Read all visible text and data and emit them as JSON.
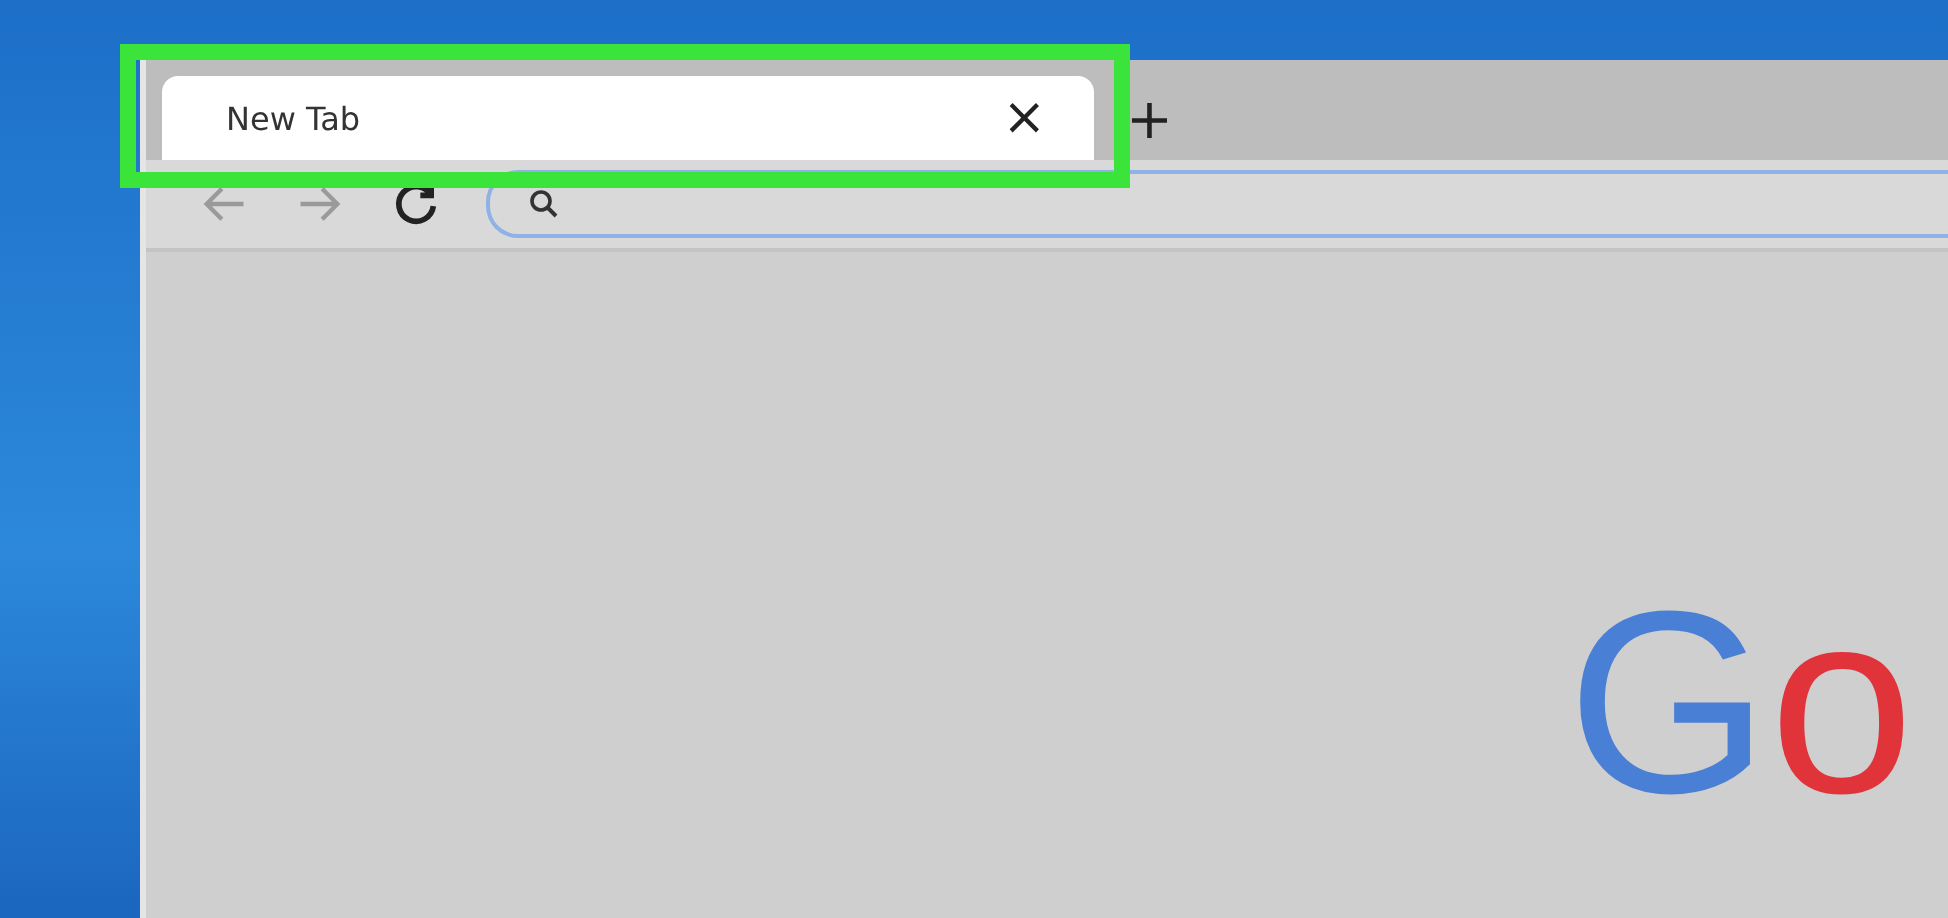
{
  "tabs": [
    {
      "label": "New Tab",
      "close": "×",
      "selected": true,
      "highlighted": true
    }
  ],
  "new_tab": "+",
  "logo": "Go"
}
